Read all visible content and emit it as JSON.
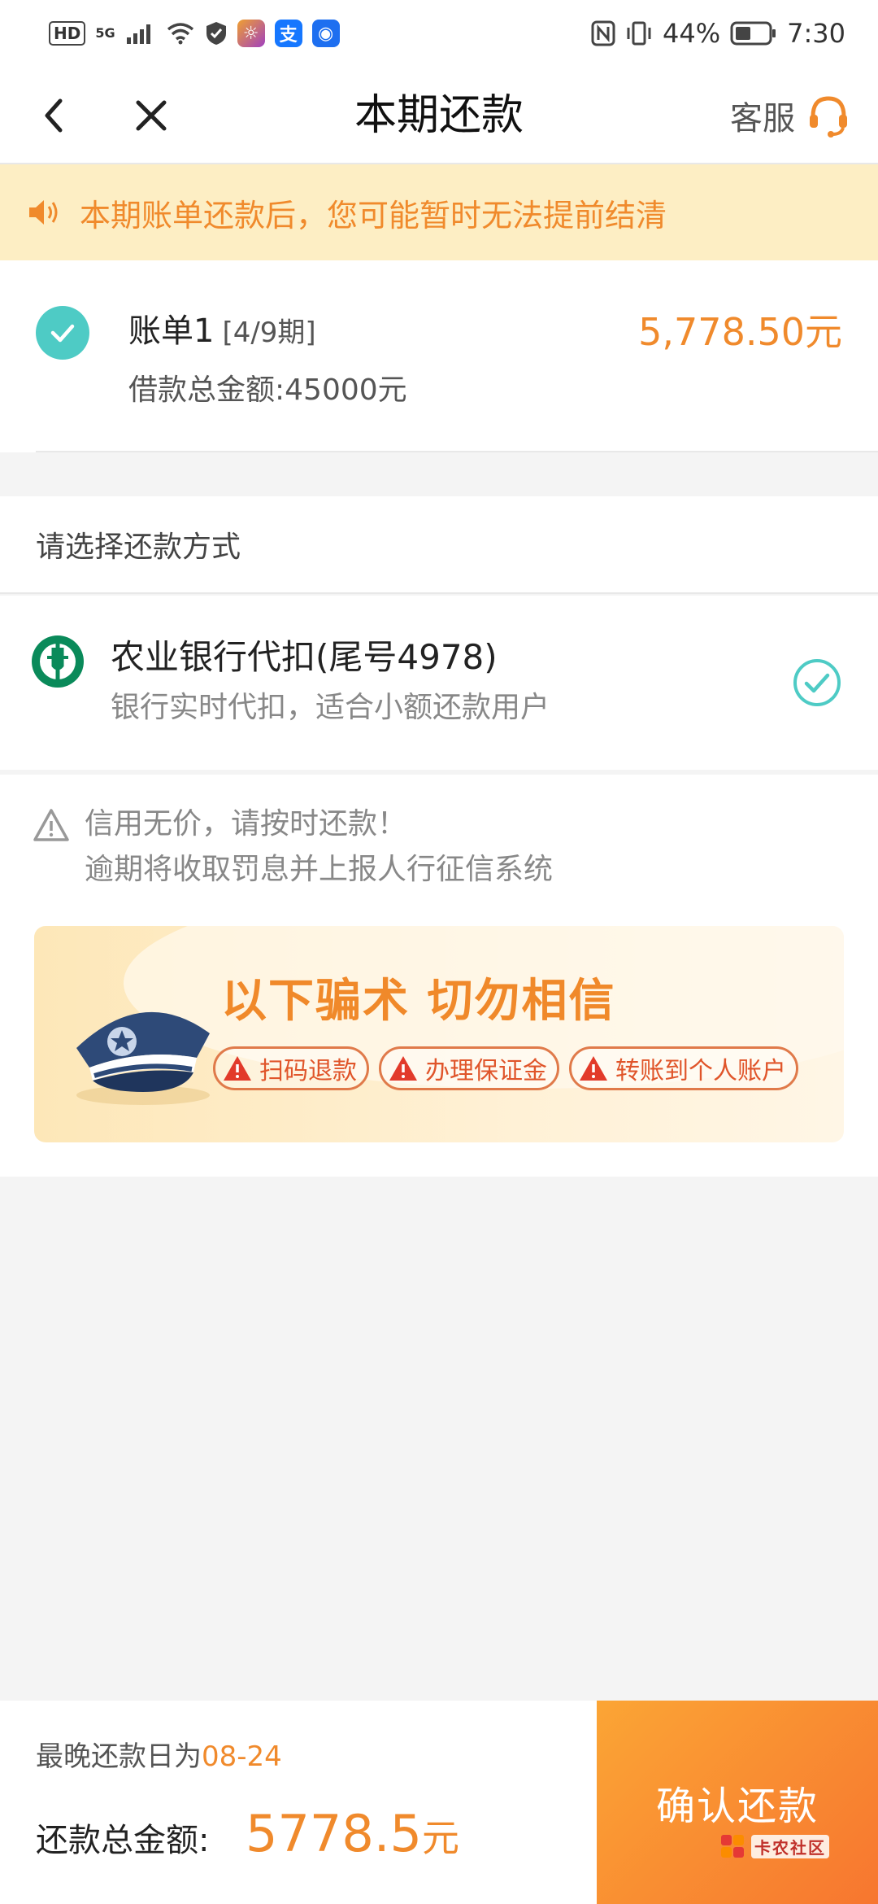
{
  "status_bar": {
    "hd": "HD",
    "net": "5G",
    "battery": "44%",
    "time": "7:30"
  },
  "header": {
    "title": "本期还款",
    "service_label": "客服"
  },
  "notice": {
    "text": "本期账单还款后，您可能暂时无法提前结清"
  },
  "bill": {
    "title": "账单1",
    "period": "[4/9期]",
    "amount": "5,778.50元",
    "loan_total": "借款总金额:45000元"
  },
  "repay_method": {
    "header": "请选择还款方式",
    "bank_name": "农业银行代扣(尾号4978)",
    "bank_desc": "银行实时代扣，适合小额还款用户"
  },
  "warning": {
    "line1": "信用无价，请按时还款！",
    "line2": "逾期将收取罚息并上报人行征信系统"
  },
  "fraud_banner": {
    "title": "以下骗术 切勿相信",
    "tags": [
      "扫码退款",
      "办理保证金",
      "转账到个人账户"
    ]
  },
  "bottom": {
    "due_label": "最晚还款日为",
    "due_date": "08-24",
    "total_label": "还款总金额:",
    "total_amount": "5778.5",
    "total_unit": "元",
    "confirm_label": "确认还款",
    "watermark": "卡农社区"
  },
  "colors": {
    "accent": "#f08a2c",
    "check_teal": "#4ecbc5",
    "notice_bg": "#fdeec4",
    "button_start": "#fba535",
    "button_end": "#f7762f"
  }
}
